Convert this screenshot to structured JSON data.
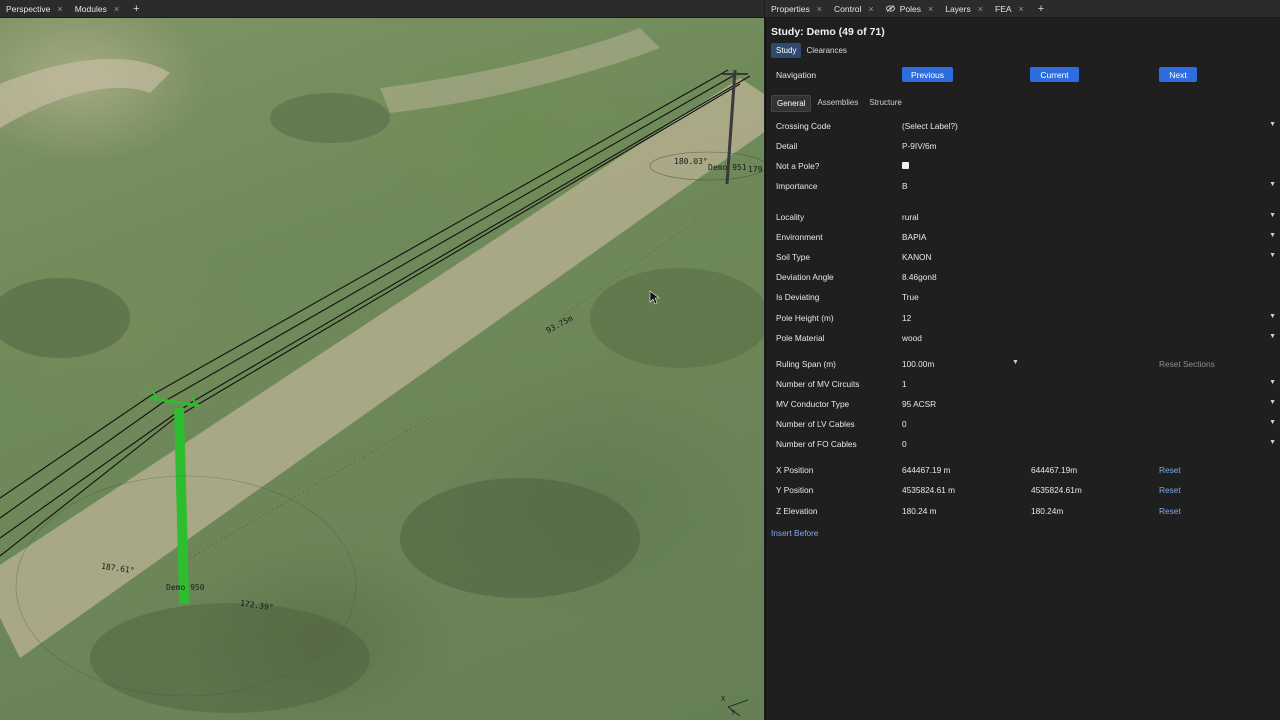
{
  "left_tabs": [
    {
      "label": "Perspective"
    },
    {
      "label": "Modules"
    }
  ],
  "right_tabs": [
    {
      "label": "Properties"
    },
    {
      "label": "Control"
    },
    {
      "label": "Poles"
    },
    {
      "label": "Layers"
    },
    {
      "label": "FEA"
    }
  ],
  "add_tab_symbol": "+",
  "close_symbol": "×",
  "viewport": {
    "labels": {
      "pole_951_angle": "180.03°",
      "pole_951_name": "Demo 951",
      "pole_951_suffix": "179",
      "span_length": "93.75m",
      "pole_950_name": "Demo 950",
      "pole_950_angle_left": "187.61°",
      "pole_950_angle_right": "172.39°"
    },
    "axis": {
      "x": "X",
      "y": "Y"
    },
    "colors": {
      "selected_pole": "#2ebd2e",
      "conductor": "#111111"
    }
  },
  "panel": {
    "title": "Study: Demo (49 of 71)",
    "subtabs": [
      {
        "label": "Study",
        "active": true
      },
      {
        "label": "Clearances",
        "active": false
      }
    ],
    "navigation": {
      "label": "Navigation",
      "previous": "Previous",
      "current": "Current",
      "next": "Next"
    },
    "general_tabs": [
      {
        "label": "General",
        "active": true
      },
      {
        "label": "Assemblies",
        "active": false
      },
      {
        "label": "Structure",
        "active": false
      }
    ],
    "fields": {
      "crossing_code": {
        "label": "Crossing Code",
        "value": "(Select Label?)"
      },
      "detail": {
        "label": "Detail",
        "value": "P-9IV/6m"
      },
      "not_a_pole": {
        "label": "Not a Pole?",
        "checked": false
      },
      "importance": {
        "label": "Importance",
        "value": "B"
      },
      "locality": {
        "label": "Locality",
        "value": "rural"
      },
      "environment": {
        "label": "Environment",
        "value": "BAPIA"
      },
      "soil_type": {
        "label": "Soil Type",
        "value": "KANON"
      },
      "deviation_angle": {
        "label": "Deviation Angle",
        "value": "8.46gonȣ"
      },
      "is_deviating": {
        "label": "Is Deviating",
        "value": "True"
      },
      "pole_height": {
        "label": "Pole Height (m)",
        "value": "12"
      },
      "pole_material": {
        "label": "Pole Material",
        "value": "wood"
      },
      "ruling_span": {
        "label": "Ruling Span (m)",
        "value": "100.00m",
        "action": "Reset Sections"
      },
      "mv_circuits": {
        "label": "Number of MV Circuits",
        "value": "1"
      },
      "mv_conductor": {
        "label": "MV Conductor Type",
        "value": "95 ACSR"
      },
      "lv_cables": {
        "label": "Number of LV Cables",
        "value": "0"
      },
      "fo_cables": {
        "label": "Number of FO Cables",
        "value": "0"
      },
      "x_position": {
        "label": "X Position",
        "value": "644467.19 m",
        "computed": "644467.19m",
        "action": "Reset"
      },
      "y_position": {
        "label": "Y Position",
        "value": "4535824.61 m",
        "computed": "4535824.61m",
        "action": "Reset"
      },
      "z_elevation": {
        "label": "Z Elevation",
        "value": "180.24 m",
        "computed": "180.24m",
        "action": "Reset"
      }
    },
    "insert_before": "Insert Before",
    "colors": {
      "accent": "#2f6ddf",
      "link": "#7fa8ee"
    }
  }
}
